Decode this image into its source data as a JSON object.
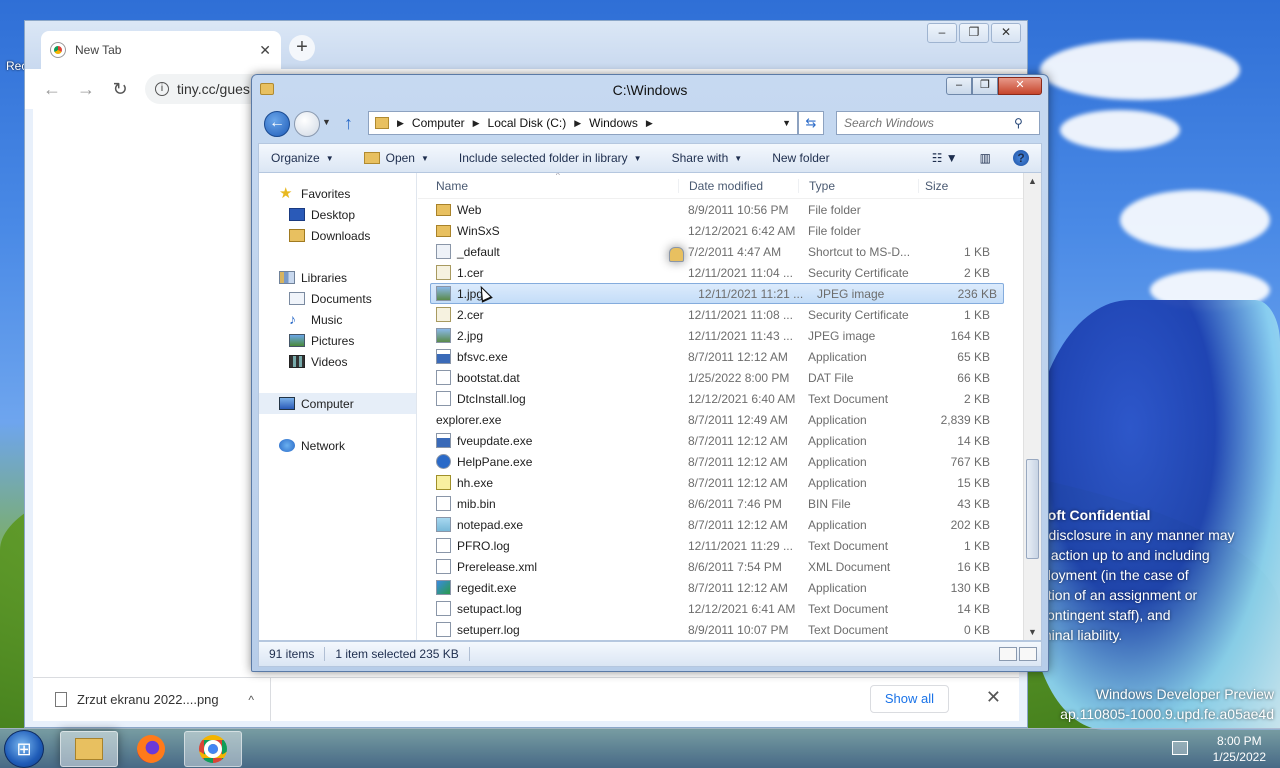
{
  "desktop": {
    "icon_label": "Rec",
    "watermark": {
      "title": "soft Confidential",
      "lines": [
        "r disclosure in any manner may",
        "y action up to and including",
        "ployment (in the case of",
        "ation of an assignment or",
        "contingent staff), and",
        "minal liability."
      ]
    },
    "build": {
      "line1": "Windows Developer Preview",
      "line2": "ap.110805-1000.9.upd.fe.a05ae4d"
    }
  },
  "chrome": {
    "tab_title": "New Tab",
    "tab_close": "✕",
    "new_tab": "+",
    "window_buttons": [
      "–",
      "❐",
      "✕"
    ],
    "nav": {
      "back": "←",
      "forward": "→",
      "reload": "↻"
    },
    "url": "tiny.cc/gues",
    "download": {
      "name": "Zrzut ekranu 2022....png",
      "chevron": "^"
    },
    "show_all": "Show all",
    "close_downloads": "✕"
  },
  "explorer": {
    "title": "C:\\Windows",
    "window_buttons": [
      "–",
      "❐",
      "✕"
    ],
    "breadcrumb": [
      "Computer",
      "Local Disk (C:)",
      "Windows"
    ],
    "search_placeholder": "Search Windows",
    "commands": {
      "organize": "Organize",
      "open": "Open",
      "include": "Include selected folder in library",
      "share": "Share with",
      "new_folder": "New folder",
      "help": "?"
    },
    "nav": {
      "favorites": "Favorites",
      "desktop": "Desktop",
      "downloads": "Downloads",
      "libraries": "Libraries",
      "documents": "Documents",
      "music": "Music",
      "pictures": "Pictures",
      "videos": "Videos",
      "computer": "Computer",
      "network": "Network"
    },
    "columns": {
      "name": "Name",
      "date": "Date modified",
      "type": "Type",
      "size": "Size"
    },
    "files": [
      {
        "name": "Web",
        "date": "8/9/2011 10:56 PM",
        "type": "File folder",
        "size": "",
        "icon": "folder"
      },
      {
        "name": "WinSxS",
        "date": "12/12/2021 6:42 AM",
        "type": "File folder",
        "size": "",
        "icon": "folder"
      },
      {
        "name": "_default",
        "date": "7/2/2011 4:47 AM",
        "type": "Shortcut to MS-D...",
        "size": "1 KB",
        "icon": "shortcut"
      },
      {
        "name": "1.cer",
        "date": "12/11/2021 11:04 ...",
        "type": "Security Certificate",
        "size": "2 KB",
        "icon": "cert"
      },
      {
        "name": "1.jpg",
        "date": "12/11/2021 11:21 ...",
        "type": "JPEG image",
        "size": "236 KB",
        "icon": "image"
      },
      {
        "name": "2.cer",
        "date": "12/11/2021 11:08 ...",
        "type": "Security Certificate",
        "size": "1 KB",
        "icon": "cert"
      },
      {
        "name": "2.jpg",
        "date": "12/11/2021 11:43 ...",
        "type": "JPEG image",
        "size": "164 KB",
        "icon": "image"
      },
      {
        "name": "bfsvc.exe",
        "date": "8/7/2011 12:12 AM",
        "type": "Application",
        "size": "65 KB",
        "icon": "app"
      },
      {
        "name": "bootstat.dat",
        "date": "1/25/2022 8:00 PM",
        "type": "DAT File",
        "size": "66 KB",
        "icon": "doc"
      },
      {
        "name": "DtcInstall.log",
        "date": "12/12/2021 6:40 AM",
        "type": "Text Document",
        "size": "2 KB",
        "icon": "doc"
      },
      {
        "name": "explorer.exe",
        "date": "8/7/2011 12:49 AM",
        "type": "Application",
        "size": "2,839 KB",
        "icon": "explorer"
      },
      {
        "name": "fveupdate.exe",
        "date": "8/7/2011 12:12 AM",
        "type": "Application",
        "size": "14 KB",
        "icon": "app"
      },
      {
        "name": "HelpPane.exe",
        "date": "8/7/2011 12:12 AM",
        "type": "Application",
        "size": "767 KB",
        "icon": "help"
      },
      {
        "name": "hh.exe",
        "date": "8/7/2011 12:12 AM",
        "type": "Application",
        "size": "15 KB",
        "icon": "hh"
      },
      {
        "name": "mib.bin",
        "date": "8/6/2011 7:46 PM",
        "type": "BIN File",
        "size": "43 KB",
        "icon": "doc"
      },
      {
        "name": "notepad.exe",
        "date": "8/7/2011 12:12 AM",
        "type": "Application",
        "size": "202 KB",
        "icon": "notepad"
      },
      {
        "name": "PFRO.log",
        "date": "12/11/2021 11:29 ...",
        "type": "Text Document",
        "size": "1 KB",
        "icon": "doc"
      },
      {
        "name": "Prerelease.xml",
        "date": "8/6/2011 7:54 PM",
        "type": "XML Document",
        "size": "16 KB",
        "icon": "doc"
      },
      {
        "name": "regedit.exe",
        "date": "8/7/2011 12:12 AM",
        "type": "Application",
        "size": "130 KB",
        "icon": "reg"
      },
      {
        "name": "setupact.log",
        "date": "12/12/2021 6:41 AM",
        "type": "Text Document",
        "size": "14 KB",
        "icon": "doc"
      },
      {
        "name": "setuperr.log",
        "date": "8/9/2011 10:07 PM",
        "type": "Text Document",
        "size": "0 KB",
        "icon": "doc"
      }
    ],
    "selected_index": 4,
    "status": {
      "items": "91 items",
      "selection": "1 item selected  235 KB"
    }
  },
  "taskbar": {
    "clock_time": "8:00 PM",
    "clock_date": "1/25/2022"
  }
}
